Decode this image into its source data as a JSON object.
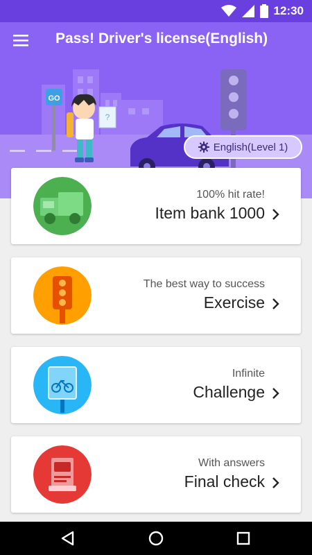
{
  "status_bar": {
    "time": "12:30"
  },
  "header": {
    "title": "Pass! Driver's license(English)",
    "go_sign": "GO"
  },
  "language": {
    "label": "English(Level 1)"
  },
  "cards": [
    {
      "subtitle": "100% hit rate!",
      "title": "Item bank 1000"
    },
    {
      "subtitle": "The best way to success",
      "title": "Exercise"
    },
    {
      "subtitle": "Infinite",
      "title": "Challenge"
    },
    {
      "subtitle": "With answers",
      "title": "Final check"
    }
  ],
  "colors": {
    "status_bar": "#6a3fe0",
    "header": "#8a62f4",
    "card_green": "#4caf50",
    "card_orange": "#ffa000",
    "card_blue": "#29b6f6",
    "card_red": "#e53935"
  },
  "icons": [
    "menu-icon",
    "wifi-icon",
    "signal-icon",
    "battery-icon",
    "gear-icon",
    "truck-icon",
    "traffic-light-icon",
    "bicycle-sign-icon",
    "document-icon",
    "chevron-right-icon",
    "back-icon",
    "home-icon",
    "recent-apps-icon"
  ]
}
